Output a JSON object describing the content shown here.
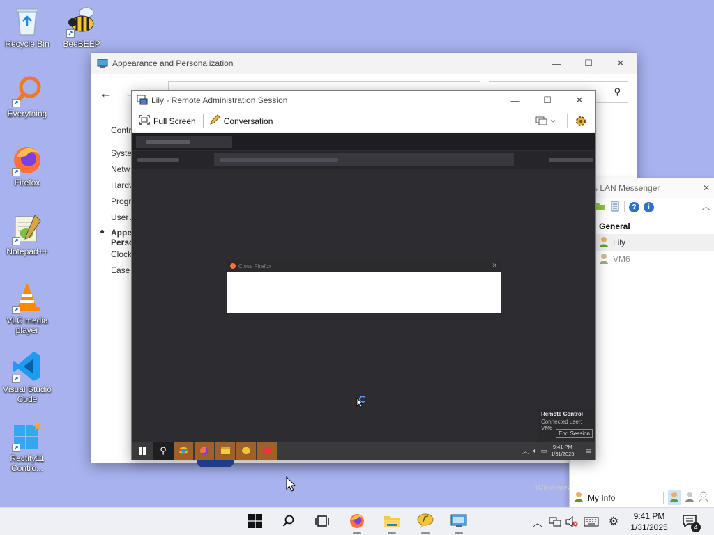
{
  "desktop": {
    "icons": [
      {
        "label": "Recycle Bin"
      },
      {
        "label": "BeeBEEP"
      },
      {
        "label": "Everything"
      },
      {
        "label": "Firefox"
      },
      {
        "label": "Notepad++"
      },
      {
        "label": "VLC media player"
      },
      {
        "label": "Visual Studio Code"
      },
      {
        "label": "Rectify11 Contro..."
      }
    ]
  },
  "control_panel": {
    "title": "Appearance and Personalization",
    "side_items": [
      "Contr",
      "Syste",
      "Netw",
      "Hardv",
      "Progr",
      "User A",
      "Appe",
      "Perso",
      "Clock",
      "Ease"
    ]
  },
  "remote_session": {
    "title": "Lily - Remote Administration Session",
    "toolbar": {
      "fullscreen_label": "Full Screen",
      "conversation_label": "Conversation"
    },
    "inner_window_title": "Close Firefox",
    "remote_panel": {
      "title": "Remote Control",
      "subtitle": "Connected user: VM6",
      "end_label": "End Session"
    },
    "remote_clock": {
      "time": "9:41 PM",
      "date": "1/31/2025"
    }
  },
  "lan_messenger": {
    "title": "s LAN Messenger",
    "group": "General",
    "users": [
      {
        "name": "Lily",
        "status": "online"
      },
      {
        "name": "VM6",
        "status": "offline"
      }
    ],
    "my_info_label": "My Info"
  },
  "taskbar": {
    "clock": {
      "time": "9:41 PM",
      "date": "1/31/2025"
    },
    "notification_count": "4"
  },
  "watermark": "Windows",
  "colors": {
    "desktop": "#a7b2ee",
    "taskbar": "#eef0f4",
    "accent": "#0067c0",
    "remote_bg": "#2d2d31"
  }
}
